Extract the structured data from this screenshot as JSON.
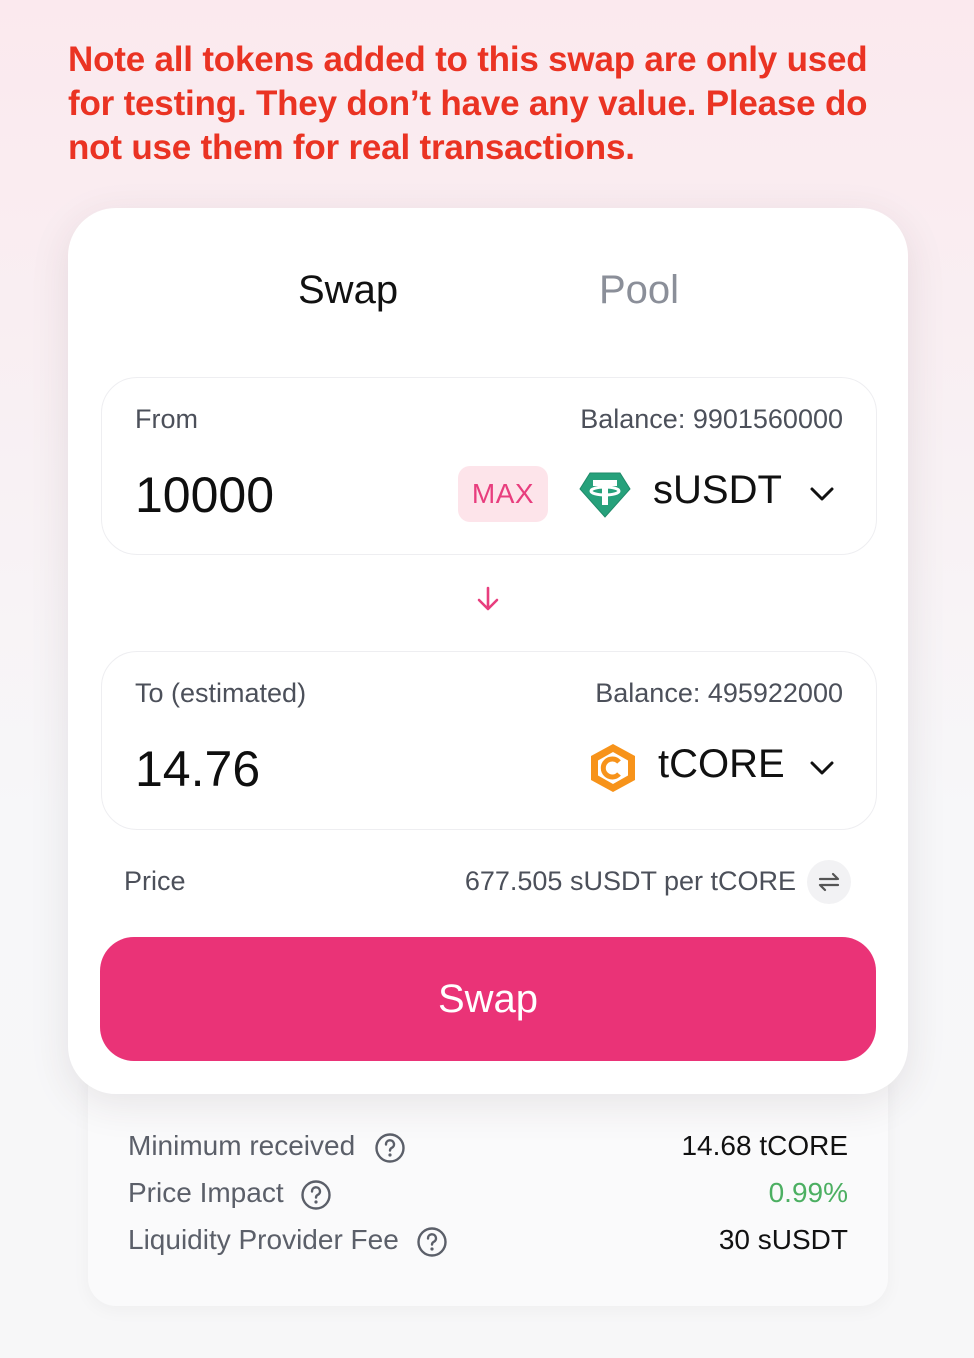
{
  "notice": "Note all tokens added to this swap are only used for testing. They don’t have any value. Please do not use them for real transactions.",
  "tabs": {
    "swap": "Swap",
    "pool": "Pool"
  },
  "from": {
    "label": "From",
    "balance": "Balance: 9901560000",
    "amount": "10000",
    "max_label": "MAX",
    "token": "sUSDT",
    "token_icon": "tether-icon"
  },
  "to": {
    "label": "To (estimated)",
    "balance": "Balance: 495922000",
    "amount": "14.76",
    "token": "tCORE",
    "token_icon": "core-icon"
  },
  "price": {
    "label": "Price",
    "value": "677.505 sUSDT per tCORE"
  },
  "swap_button": "Swap",
  "details": {
    "min_received": {
      "label": "Minimum received",
      "value": "14.68 tCORE"
    },
    "price_impact": {
      "label": "Price Impact",
      "value": "0.99%"
    },
    "lp_fee": {
      "label": "Liquidity Provider Fee",
      "value": "30 sUSDT"
    }
  },
  "colors": {
    "accent": "#ea3377",
    "warning": "#ea3323",
    "positive": "#4caf62",
    "tether": "#26a17b",
    "core": "#f7931a"
  }
}
